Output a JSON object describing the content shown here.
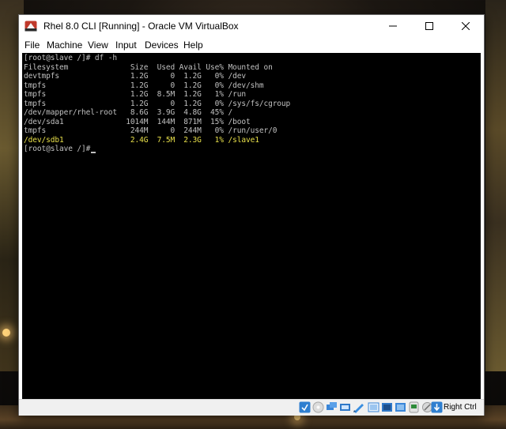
{
  "window": {
    "title": "Rhel 8.0 CLI [Running] - Oracle VM VirtualBox"
  },
  "menu": [
    "File",
    "Machine",
    "View",
    "Input",
    "Devices",
    "Help"
  ],
  "terminal": {
    "lines": [
      "[root@slave /]# df -h",
      "Filesystem              Size  Used Avail Use% Mounted on",
      "devtmpfs                1.2G     0  1.2G   0% /dev",
      "tmpfs                   1.2G     0  1.2G   0% /dev/shm",
      "tmpfs                   1.2G  8.5M  1.2G   1% /run",
      "tmpfs                   1.2G     0  1.2G   0% /sys/fs/cgroup",
      "/dev/mapper/rhel-root   8.6G  3.9G  4.8G  45% /",
      "/dev/sda1              1014M  144M  871M  15% /boot",
      "tmpfs                   244M     0  244M   0% /run/user/0",
      "/dev/sdb1               2.4G  7.5M  2.3G   1% /slave1",
      "[root@slave /]#"
    ],
    "highlight_line_index": 9,
    "text_color": "#c0c0c0",
    "highlight_color": "#e8e04a"
  },
  "statusbar": {
    "host_key": "Right Ctrl",
    "icons": [
      "optical-drive-icon",
      "audio-icon",
      "network-icon",
      "usb-icon",
      "shared-folder-icon",
      "display-icon",
      "video-capture-icon",
      "cpu-icon",
      "mouse-integration-icon",
      "keyboard-capture-icon"
    ]
  }
}
